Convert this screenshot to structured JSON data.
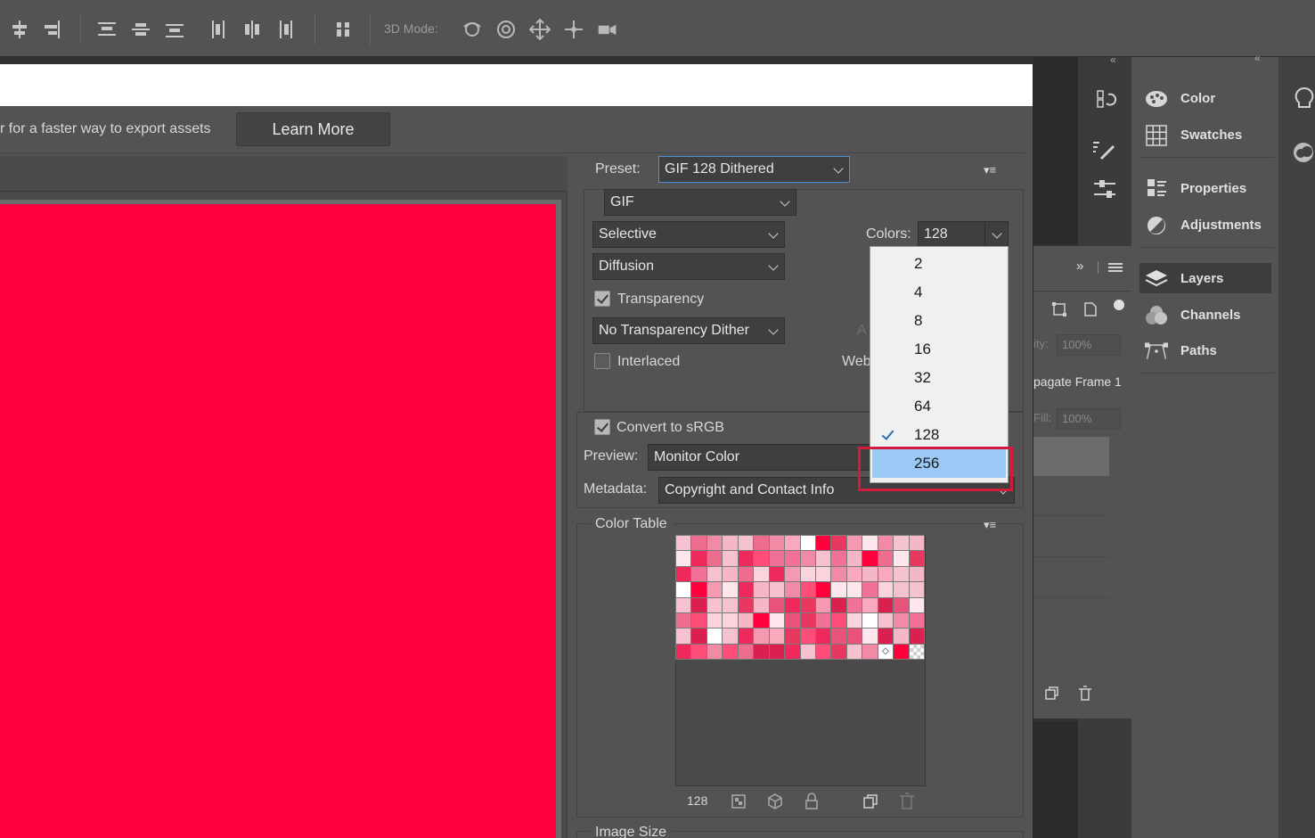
{
  "toolbar": {
    "mode_label": "3D Mode:"
  },
  "banner": {
    "text": "r for a faster way to export assets",
    "learn_more": "Learn More"
  },
  "canvas": {
    "color": "#ff003c"
  },
  "settings": {
    "preset_label": "Preset:",
    "preset_value": "GIF 128 Dithered",
    "format_value": "GIF",
    "reduction_value": "Selective",
    "dither_value": "Diffusion",
    "colors_label": "Colors:",
    "colors_value": "128",
    "transparency_label": "Transparency",
    "transparency_checked": true,
    "transparency_dither_value": "No Transparency Dither",
    "matte_partial": "A",
    "interlaced_label": "Interlaced",
    "interlaced_checked": false,
    "web_snap_partial": "Web",
    "convert_srgb_label": "Convert to sRGB",
    "convert_srgb_checked": true,
    "preview_label": "Preview:",
    "preview_value": "Monitor Color",
    "metadata_label": "Metadata:",
    "metadata_value": "Copyright and Contact Info"
  },
  "colors_dropdown": {
    "options": [
      "2",
      "4",
      "8",
      "16",
      "32",
      "64",
      "128",
      "256"
    ],
    "checked": "128",
    "highlighted": "256"
  },
  "color_table": {
    "title": "Color Table",
    "count": "128"
  },
  "image_size": {
    "title": "Image Size"
  },
  "layers_panel": {
    "opacity_label": "ity:",
    "opacity_value": "100%",
    "propagate_label": "pagate Frame 1",
    "fill_label": "Fill:",
    "fill_value": "100%"
  },
  "right_panels": {
    "items": [
      {
        "label": "Color",
        "icon": "palette-icon"
      },
      {
        "label": "Swatches",
        "icon": "swatches-grid-icon"
      },
      {
        "label": "Properties",
        "icon": "properties-icon"
      },
      {
        "label": "Adjustments",
        "icon": "adjustments-icon"
      },
      {
        "label": "Layers",
        "icon": "layers-icon"
      },
      {
        "label": "Channels",
        "icon": "channels-icon"
      },
      {
        "label": "Paths",
        "icon": "paths-icon"
      }
    ]
  },
  "colors": {
    "accent_highlight": "#d21b3d",
    "selection_blue": "#99c9f4"
  }
}
